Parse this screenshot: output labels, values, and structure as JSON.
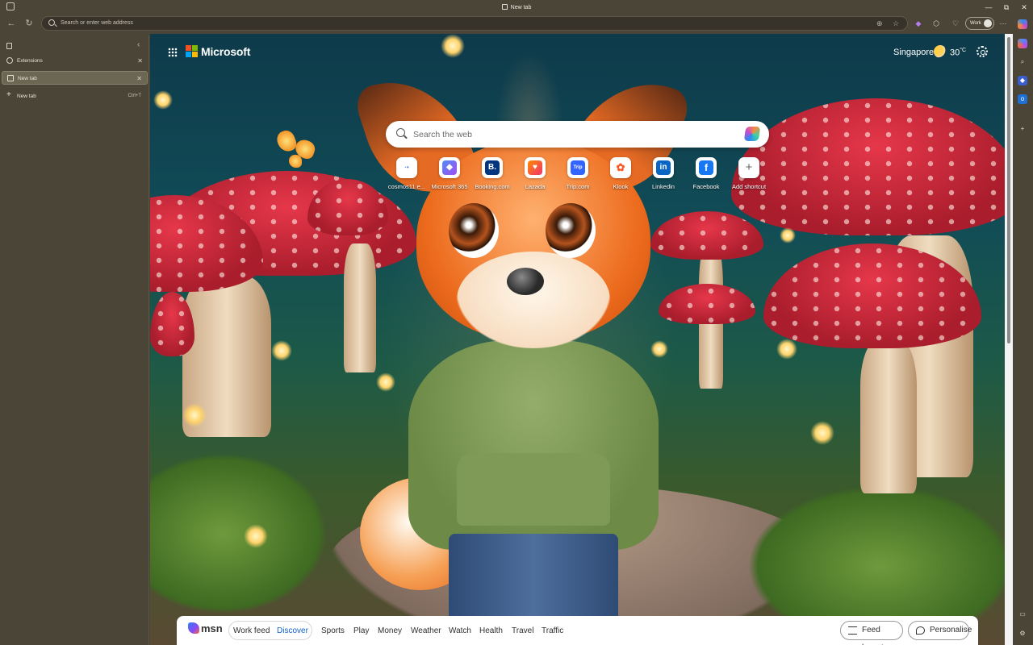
{
  "window": {
    "title": "New tab",
    "controls": {
      "minimize": "—",
      "restore": "⧉",
      "close": "✕"
    }
  },
  "toolbar": {
    "address_placeholder": "Search or enter web address",
    "profile_label": "Work"
  },
  "sidebar": {
    "tabs": [
      {
        "label": "Extensions",
        "active": false
      },
      {
        "label": "New tab",
        "active": true
      }
    ],
    "new_tab_label": "New tab",
    "new_tab_shortcut": "Ctrl+T"
  },
  "page": {
    "brand": "Microsoft",
    "weather_city": "Singapore",
    "temperature": "30",
    "temperature_unit": "°C",
    "search_placeholder": "Search the web",
    "shortcuts": [
      {
        "label": "cosmos11 e...",
        "glyph": "·•",
        "color": "#5a8be0"
      },
      {
        "label": "Microsoft 365",
        "glyph": "◆",
        "color": "#7a5af5"
      },
      {
        "label": "Booking.com",
        "glyph": "B.",
        "color": "#003580"
      },
      {
        "label": "Lazada",
        "glyph": "♥",
        "color": "#f0336e"
      },
      {
        "label": "Trip.com",
        "glyph": "Trip",
        "color": "#3264ff"
      },
      {
        "label": "Klook",
        "glyph": "✿",
        "color": "#ff5722"
      },
      {
        "label": "Linkedin",
        "glyph": "in",
        "color": "#0a66c2"
      },
      {
        "label": "Facebook",
        "glyph": "f",
        "color": "#1877f2"
      },
      {
        "label": "Add shortcut",
        "glyph": "+",
        "color": "#ffffff"
      }
    ]
  },
  "feed": {
    "brand": "msn",
    "tabs": [
      "Work feed",
      "Discover",
      "Sports",
      "Play",
      "Money",
      "Weather",
      "Watch",
      "Health",
      "Travel",
      "Traffic"
    ],
    "active_tab": "Discover",
    "feed_layout_label": "Feed layout",
    "personalise_label": "Personalise"
  }
}
